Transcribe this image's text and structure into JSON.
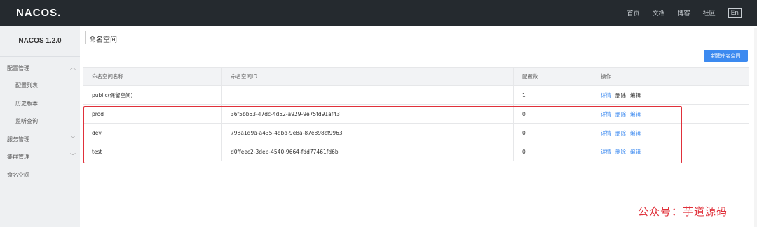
{
  "header": {
    "logo": "NACOS.",
    "nav": [
      "首页",
      "文档",
      "博客",
      "社区"
    ],
    "lang": "En"
  },
  "sidebar": {
    "title": "NACOS 1.2.0",
    "items": [
      {
        "label": "配置管理",
        "expanded": true
      },
      {
        "label": "配置列表"
      },
      {
        "label": "历史版本"
      },
      {
        "label": "监听查询"
      },
      {
        "label": "服务管理",
        "expanded": false
      },
      {
        "label": "集群管理",
        "expanded": false
      },
      {
        "label": "命名空间"
      }
    ]
  },
  "main": {
    "title": "命名空间",
    "new_button": "新建命名空间",
    "table": {
      "headers": [
        "命名空间名称",
        "命名空间ID",
        "配置数",
        "操作"
      ],
      "rows": [
        {
          "name": "public(保留空间)",
          "id": "",
          "count": "1",
          "ops": [
            "详情",
            "删除",
            "编辑"
          ]
        },
        {
          "name": "prod",
          "id": "36f5bb53-47dc-4d52-a929-9e75fd91af43",
          "count": "0",
          "ops": [
            "详情",
            "删除",
            "编辑"
          ]
        },
        {
          "name": "dev",
          "id": "798a1d9a-a435-4dbd-9e8a-87e898cf9963",
          "count": "0",
          "ops": [
            "详情",
            "删除",
            "编辑"
          ]
        },
        {
          "name": "test",
          "id": "d0ffeec2-3deb-4540-9664-fdd77461fd6b",
          "count": "0",
          "ops": [
            "详情",
            "删除",
            "编辑"
          ]
        }
      ]
    }
  },
  "watermark": "公众号：芋道源码",
  "colors": {
    "accent": "#3c8af0",
    "header_bg": "#252a2f",
    "highlight": "#e0303a"
  }
}
